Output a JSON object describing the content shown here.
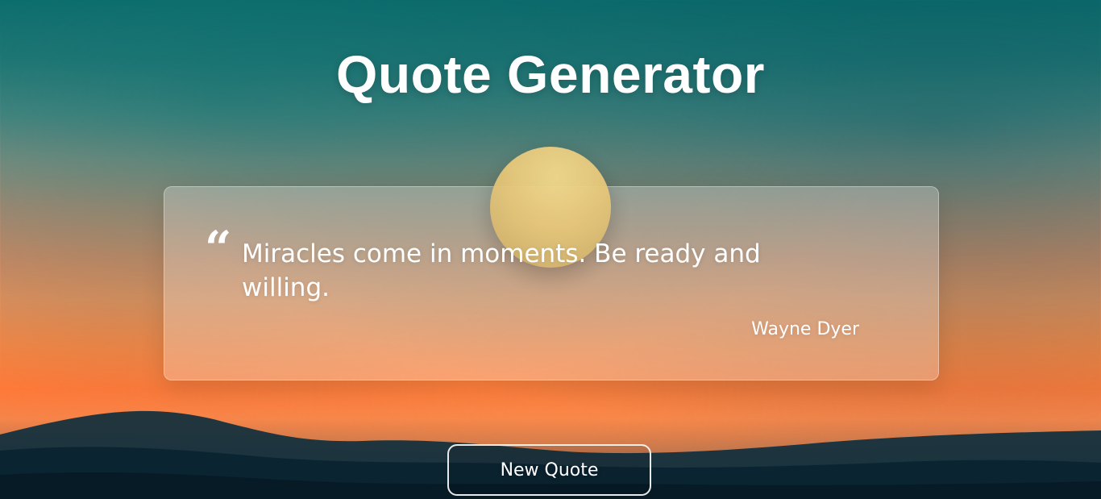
{
  "page": {
    "title": "Quote Generator"
  },
  "quote": {
    "mark": "“",
    "text": "Miracles come in moments. Be ready and willing.",
    "author": "Wayne Dyer"
  },
  "actions": {
    "new_quote_label": "New Quote"
  },
  "colors": {
    "text": "#ffffff",
    "card_bg": "rgba(255,255,255,0.26)",
    "card_border": "rgba(255,255,255,0.35)",
    "sun": "#e6c779"
  }
}
